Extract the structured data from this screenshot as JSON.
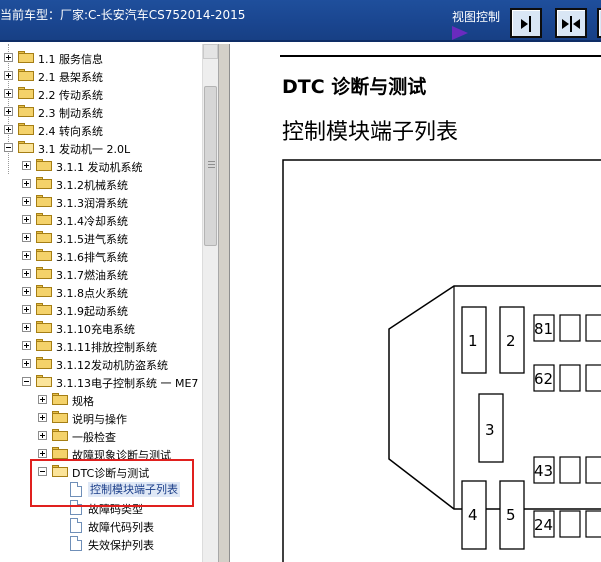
{
  "topbar": {
    "vehicle_line": "当前车型：厂家:C-长安汽车CS752014-2015",
    "view_control_label": "视图控制"
  },
  "tree": {
    "items": [
      {
        "label": "1.1  服务信息",
        "expander": "plus",
        "icon": "folder-icon"
      },
      {
        "label": "2.1  悬架系统",
        "expander": "plus",
        "icon": "folder-icon"
      },
      {
        "label": "2.2  传动系统",
        "expander": "plus",
        "icon": "folder-icon"
      },
      {
        "label": "2.3  制动系统",
        "expander": "plus",
        "icon": "folder-icon"
      },
      {
        "label": "2.4  转向系统",
        "expander": "plus",
        "icon": "folder-icon"
      },
      {
        "label": "3.1  发动机一  2.0L",
        "expander": "minus",
        "icon": "folder-open-icon"
      },
      {
        "label": "3.1.1  发动机系统",
        "expander": "plus",
        "icon": "folder-icon"
      },
      {
        "label": "3.1.2机械系统",
        "expander": "plus",
        "icon": "folder-icon"
      },
      {
        "label": "3.1.3润滑系统",
        "expander": "plus",
        "icon": "folder-icon"
      },
      {
        "label": "3.1.4冷却系统",
        "expander": "plus",
        "icon": "folder-icon"
      },
      {
        "label": "3.1.5进气系统",
        "expander": "plus",
        "icon": "folder-icon"
      },
      {
        "label": "3.1.6排气系统",
        "expander": "plus",
        "icon": "folder-icon"
      },
      {
        "label": "3.1.7燃油系统",
        "expander": "plus",
        "icon": "folder-icon"
      },
      {
        "label": "3.1.8点火系统",
        "expander": "plus",
        "icon": "folder-icon"
      },
      {
        "label": "3.1.9起动系统",
        "expander": "plus",
        "icon": "folder-icon"
      },
      {
        "label": "3.1.10充电系统",
        "expander": "plus",
        "icon": "folder-icon"
      },
      {
        "label": "3.1.11排放控制系统",
        "expander": "plus",
        "icon": "folder-icon"
      },
      {
        "label": "3.1.12发动机防盗系统",
        "expander": "plus",
        "icon": "folder-icon"
      },
      {
        "label": "3.1.13电子控制系统 一 ME7",
        "expander": "minus",
        "icon": "folder-open-icon"
      },
      {
        "label": "规格",
        "expander": "plus",
        "icon": "folder-icon"
      },
      {
        "label": "说明与操作",
        "expander": "plus",
        "icon": "folder-icon"
      },
      {
        "label": "一般检查",
        "expander": "plus",
        "icon": "folder-icon"
      },
      {
        "label": "故障现象诊断与测试",
        "expander": "plus",
        "icon": "folder-icon"
      },
      {
        "label": "DTC诊断与测试",
        "expander": "minus",
        "icon": "folder-open-icon"
      },
      {
        "label": "控制模块端子列表",
        "expander": "none",
        "icon": "document-icon",
        "selected": true
      },
      {
        "label": "故障码类型",
        "expander": "none",
        "icon": "document-icon"
      },
      {
        "label": "故障代码列表",
        "expander": "none",
        "icon": "document-icon"
      },
      {
        "label": "失效保护列表",
        "expander": "none",
        "icon": "document-icon"
      }
    ]
  },
  "content": {
    "dtc_title": "DTC 诊断与测试",
    "page_title": "控制模块端子列表",
    "connector_pins": [
      "1",
      "2",
      "3",
      "4",
      "5",
      "81",
      "62",
      "43",
      "24"
    ]
  },
  "colors": {
    "topbar": "#1a4690",
    "highlight_box": "#e0201e",
    "view_arrow": "#6a2bbf",
    "folder": "#f4d26a",
    "selected_text": "#1c3f8a"
  }
}
